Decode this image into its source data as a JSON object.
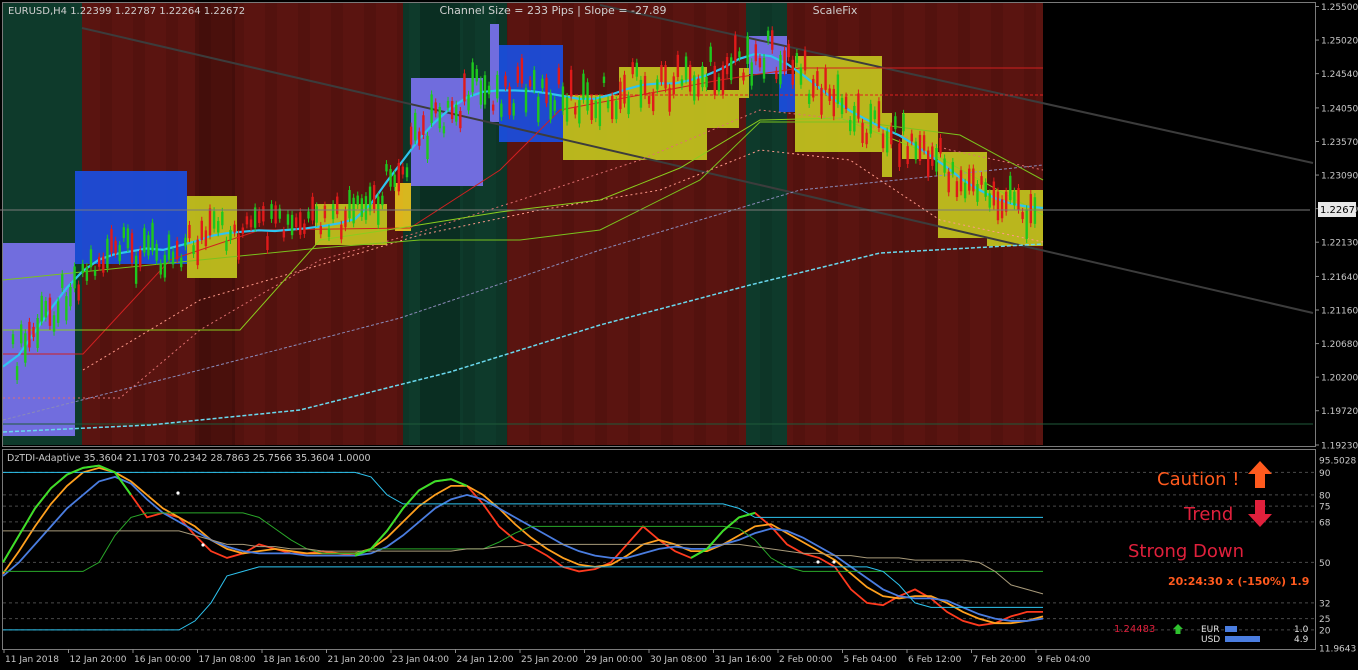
{
  "main_panel": {
    "header_left": "EURUSD,H4  1.22399 1.22787 1.22264 1.22672",
    "header_center": "Channel Size = 233 Pips  |  Slope = -27.89",
    "header_right": "ScaleFix",
    "current_price_label": "1.22672"
  },
  "indicator_panel": {
    "header": "DzTDI-Adaptive 35.3604 21.1703 70.2342 28.7863 25.7566 35.3604 1.0000",
    "caution_label": "Caution !",
    "trend_label": "Trend",
    "strong_down_label": "Strong Down",
    "timer_label": "20:24:30 x (-150%) 1.9",
    "price_red_label": "1.24483",
    "currency_rows": [
      {
        "name": "EUR",
        "value": "1.0"
      },
      {
        "name": "USD",
        "value": "4.9"
      }
    ]
  },
  "colors": {
    "bear_zone": "#5a1410",
    "bull_zone": "#0e3a2b",
    "yellow_box": "#c2c41e",
    "blue_box": "#1a4ee0",
    "violet_box": "#7a72ee",
    "cyan_ma": "#2ec4f0",
    "bull_candle": "#1ec81e",
    "bear_candle": "#e01a1a",
    "axis_text": "#c8c8c8",
    "caution": "#ff5a1e",
    "trend_red": "#e0203c"
  },
  "chart_data": [
    {
      "type": "line",
      "symbol": "EURUSD",
      "timeframe": "H4",
      "ohlc_header": {
        "open": 1.22399,
        "high": 1.22787,
        "low": 1.22264,
        "close": 1.22672
      },
      "channel_size_pips": 233,
      "slope": -27.89,
      "current_price": 1.22672,
      "ylim": [
        1.1923,
        1.2555
      ],
      "y_ticks": [
        "1.25500",
        "1.25020",
        "1.24540",
        "1.24050",
        "1.23570",
        "1.23090",
        "1.22610",
        "1.22130",
        "1.21640",
        "1.21160",
        "1.20680",
        "1.20200",
        "1.19720",
        "1.19230"
      ],
      "x_ticks": [
        "11 Jan 2018",
        "12 Jan 20:00",
        "16 Jan 00:00",
        "17 Jan 08:00",
        "18 Jan 16:00",
        "21 Jan 20:00",
        "23 Jan 04:00",
        "24 Jan 12:00",
        "25 Jan 20:00",
        "29 Jan 00:00",
        "30 Jan 08:00",
        "31 Jan 16:00",
        "2 Feb 00:00",
        "5 Feb 04:00",
        "6 Feb 12:00",
        "7 Feb 20:00",
        "9 Feb 04:00"
      ],
      "series": [
        {
          "values": [
            1.2035,
            1.2052,
            1.2085,
            1.2118,
            1.2148,
            1.2172,
            1.2188,
            1.2196,
            1.22,
            1.2204,
            1.2202,
            1.2208,
            1.2214,
            1.2222,
            1.2226,
            1.2228,
            1.223,
            1.2229,
            1.2231,
            1.2233,
            1.2236,
            1.224,
            1.2246,
            1.2268,
            1.23,
            1.233,
            1.236,
            1.2385,
            1.2405,
            1.242,
            1.2428,
            1.243,
            1.243,
            1.2429,
            1.2426,
            1.2422,
            1.2418,
            1.2418,
            1.2424,
            1.2432,
            1.2438,
            1.244,
            1.244,
            1.2445,
            1.2452,
            1.2462,
            1.2475,
            1.2482,
            1.2479,
            1.2468,
            1.2452,
            1.2434,
            1.2416,
            1.24,
            1.2388,
            1.2376,
            1.2366,
            1.2352,
            1.2336,
            1.232,
            1.2302,
            1.2288,
            1.2276,
            1.2268,
            1.2264,
            1.2262
          ]
        }
      ]
    },
    {
      "type": "line",
      "title": "DzTDI-Adaptive",
      "ylim": [
        11.9643,
        95.5028
      ],
      "y_ticks": [
        "95.5028",
        "90",
        "80",
        "75",
        "68",
        "50",
        "32",
        "25",
        "20",
        "11.9643"
      ],
      "series": [
        {
          "values": [
            50,
            62,
            74,
            83,
            89,
            92,
            93,
            90,
            80,
            70,
            72,
            70,
            62,
            55,
            52,
            54,
            58,
            56,
            54,
            54,
            55,
            54,
            53,
            56,
            64,
            74,
            82,
            86,
            87,
            84,
            76,
            66,
            60,
            57,
            53,
            48,
            46,
            47,
            50,
            58,
            66,
            60,
            55,
            52,
            56,
            64,
            70,
            72,
            66,
            58,
            54,
            52,
            48,
            38,
            32,
            31,
            35,
            38,
            34,
            28,
            24,
            22,
            23,
            26,
            28,
            28
          ]
        },
        {
          "values": [
            45,
            55,
            66,
            76,
            84,
            90,
            92,
            90,
            86,
            80,
            74,
            70,
            66,
            60,
            56,
            54,
            55,
            56,
            55,
            54,
            54,
            54,
            54,
            56,
            61,
            68,
            75,
            80,
            84,
            84,
            80,
            74,
            67,
            61,
            56,
            52,
            49,
            48,
            49,
            53,
            58,
            60,
            58,
            55,
            55,
            58,
            62,
            66,
            67,
            63,
            59,
            55,
            51,
            45,
            39,
            35,
            34,
            35,
            35,
            32,
            28,
            25,
            23,
            23,
            24,
            26
          ]
        },
        {
          "values": [
            44,
            50,
            58,
            66,
            74,
            80,
            86,
            88,
            85,
            78,
            72,
            68,
            64,
            60,
            57,
            55,
            54,
            54,
            54,
            53,
            53,
            53,
            53,
            54,
            57,
            62,
            68,
            74,
            78,
            80,
            78,
            74,
            70,
            66,
            62,
            58,
            55,
            53,
            52,
            52,
            54,
            56,
            57,
            56,
            56,
            58,
            60,
            63,
            65,
            64,
            61,
            57,
            53,
            48,
            43,
            38,
            35,
            34,
            34,
            33,
            30,
            27,
            25,
            24,
            24,
            25
          ]
        },
        {
          "values": [
            46,
            46,
            46,
            46,
            46,
            46,
            50,
            62,
            70,
            72,
            72,
            72,
            72,
            72,
            72,
            72,
            70,
            65,
            60,
            56,
            54,
            54,
            54,
            56,
            56,
            56,
            56,
            56,
            56,
            56,
            56,
            59,
            63,
            66,
            66,
            66,
            66,
            66,
            66,
            66,
            66,
            66,
            66,
            66,
            66,
            66,
            65,
            60,
            52,
            48,
            46,
            46,
            46,
            46,
            46,
            46,
            46,
            46,
            46,
            46,
            46,
            46,
            46,
            46,
            46,
            46
          ]
        },
        {
          "values": [
            20,
            20,
            20,
            20,
            20,
            20,
            20,
            20,
            20,
            20,
            20,
            20,
            24,
            32,
            44,
            46,
            48,
            48,
            48,
            48,
            48,
            48,
            48,
            48,
            48,
            48,
            48,
            48,
            48,
            48,
            48,
            48,
            48,
            48,
            48,
            48,
            48,
            48,
            48,
            48,
            48,
            48,
            48,
            48,
            48,
            48,
            48,
            48,
            48,
            48,
            48,
            48,
            48,
            48,
            48,
            46,
            40,
            32,
            30,
            30,
            30,
            30,
            30,
            30,
            30,
            30
          ]
        },
        {
          "values": [
            90,
            90,
            90,
            90,
            90,
            90,
            90,
            90,
            90,
            90,
            90,
            90,
            90,
            90,
            90,
            90,
            90,
            90,
            90,
            90,
            90,
            90,
            90,
            88,
            80,
            76,
            76,
            76,
            76,
            76,
            76,
            76,
            76,
            76,
            76,
            76,
            76,
            76,
            76,
            76,
            76,
            76,
            76,
            76,
            76,
            76,
            74,
            70,
            70,
            70,
            70,
            70,
            70,
            70,
            70,
            70,
            70,
            70,
            70,
            70,
            70,
            70,
            70,
            70,
            70,
            70
          ]
        },
        {
          "values": [
            64,
            64,
            64,
            64,
            64,
            64,
            64,
            64,
            64,
            64,
            64,
            64,
            62,
            60,
            58,
            58,
            57,
            57,
            56,
            56,
            55,
            55,
            55,
            55,
            55,
            55,
            55,
            55,
            55,
            56,
            56,
            57,
            57,
            58,
            58,
            58,
            58,
            58,
            58,
            58,
            58,
            58,
            58,
            58,
            58,
            58,
            58,
            57,
            56,
            55,
            54,
            54,
            53,
            53,
            52,
            52,
            52,
            51,
            51,
            51,
            51,
            50,
            46,
            40,
            38,
            36
          ]
        }
      ]
    }
  ]
}
